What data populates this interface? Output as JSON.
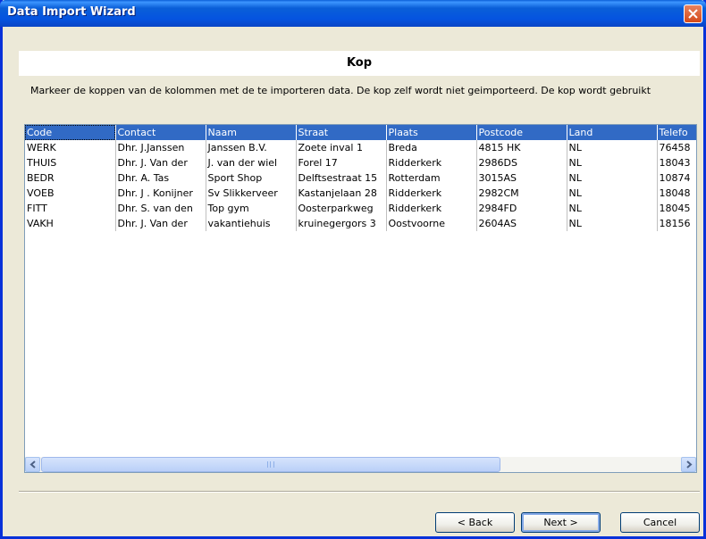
{
  "window": {
    "title": "Data Import Wizard"
  },
  "heading": "Kop",
  "instructions": "Markeer de koppen van de kolommen met de te importeren data. De kop zelf wordt niet geimporteerd. De kop wordt gebruikt",
  "table": {
    "headers": [
      "Code",
      "Contact",
      "Naam",
      "Straat",
      "Plaats",
      "Postcode",
      "Land",
      "Telefo"
    ],
    "rows": [
      [
        "WERK",
        "Dhr. J.Janssen",
        "Janssen B.V.",
        "Zoete inval 1",
        "Breda",
        "4815 HK",
        "NL",
        "76458"
      ],
      [
        "THUIS",
        "Dhr. J. Van der",
        "J. van der wiel",
        "Forel 17",
        "Ridderkerk",
        "2986DS",
        "NL",
        "18043"
      ],
      [
        "BEDR",
        "Dhr. A. Tas",
        "Sport Shop",
        "Delftsestraat 15",
        "Rotterdam",
        "3015AS",
        "NL",
        "10874"
      ],
      [
        "VOEB",
        "Dhr. J . Konijner",
        "Sv Slikkerveer",
        "Kastanjelaan 28",
        "Ridderkerk",
        "2982CM",
        "NL",
        "18048"
      ],
      [
        "FITT",
        "Dhr. S. van den",
        "Top gym",
        "Oosterparkweg",
        "Ridderkerk",
        "2984FD",
        "NL",
        "18045"
      ],
      [
        "VAKH",
        "Dhr. J. Van der",
        "vakantiehuis",
        "kruinegergors 3",
        "Oostvoorne",
        "2604AS",
        "NL",
        "18156"
      ]
    ]
  },
  "buttons": {
    "back": "< Back",
    "next": "Next >",
    "cancel": "Cancel"
  },
  "colors": {
    "titlebar": "#0a5fd8",
    "header_selected": "#316ac5",
    "dialog_bg": "#ece9d8"
  },
  "icons": {
    "close": "close-icon",
    "scroll_left": "arrow-left-icon",
    "scroll_right": "arrow-right-icon"
  }
}
